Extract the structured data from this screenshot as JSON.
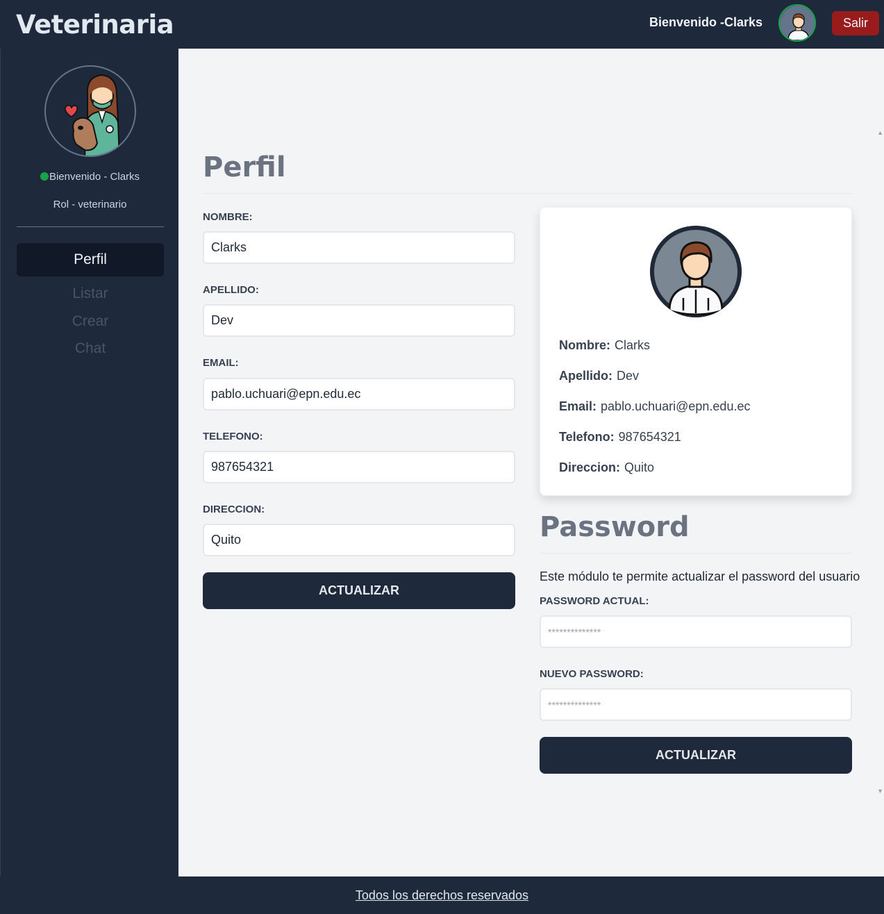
{
  "header": {
    "brand": "Veterinaria",
    "welcome": "Bienvenido -Clarks",
    "logout_label": "Salir"
  },
  "sidebar": {
    "welcome": "Bienvenido - Clarks",
    "role": "Rol - veterinario",
    "nav": [
      {
        "label": "Perfil",
        "active": true
      },
      {
        "label": "Listar",
        "active": false
      },
      {
        "label": "Crear",
        "active": false
      },
      {
        "label": "Chat",
        "active": false
      }
    ]
  },
  "profile_form": {
    "title": "Perfil",
    "fields": [
      {
        "label": "NOMBRE:",
        "value": "Clarks"
      },
      {
        "label": "APELLIDO:",
        "value": "Dev"
      },
      {
        "label": "EMAIL:",
        "value": "pablo.uchuari@epn.edu.ec"
      },
      {
        "label": "TELEFONO:",
        "value": "987654321"
      },
      {
        "label": "DIRECCION:",
        "value": "Quito"
      }
    ],
    "submit_label": "ACTUALIZAR"
  },
  "profile_card": {
    "rows": [
      {
        "label": "Nombre:",
        "value": "Clarks"
      },
      {
        "label": "Apellido:",
        "value": "Dev"
      },
      {
        "label": "Email:",
        "value": "pablo.uchuari@epn.edu.ec"
      },
      {
        "label": "Telefono:",
        "value": "987654321"
      },
      {
        "label": "Direccion:",
        "value": "Quito"
      }
    ]
  },
  "password_form": {
    "title": "Password",
    "description": "Este módulo te permite actualizar el password del usuario",
    "current_label": "PASSWORD ACTUAL:",
    "current_placeholder": "**************",
    "new_label": "NUEVO PASSWORD:",
    "new_placeholder": "**************",
    "submit_label": "ACTUALIZAR"
  },
  "footer": {
    "text": "Todos los derechos reservados"
  },
  "colors": {
    "dark": "#1e293b",
    "logout": "#991b1b",
    "online": "#16a34a",
    "content_bg": "#f3f4f6"
  }
}
